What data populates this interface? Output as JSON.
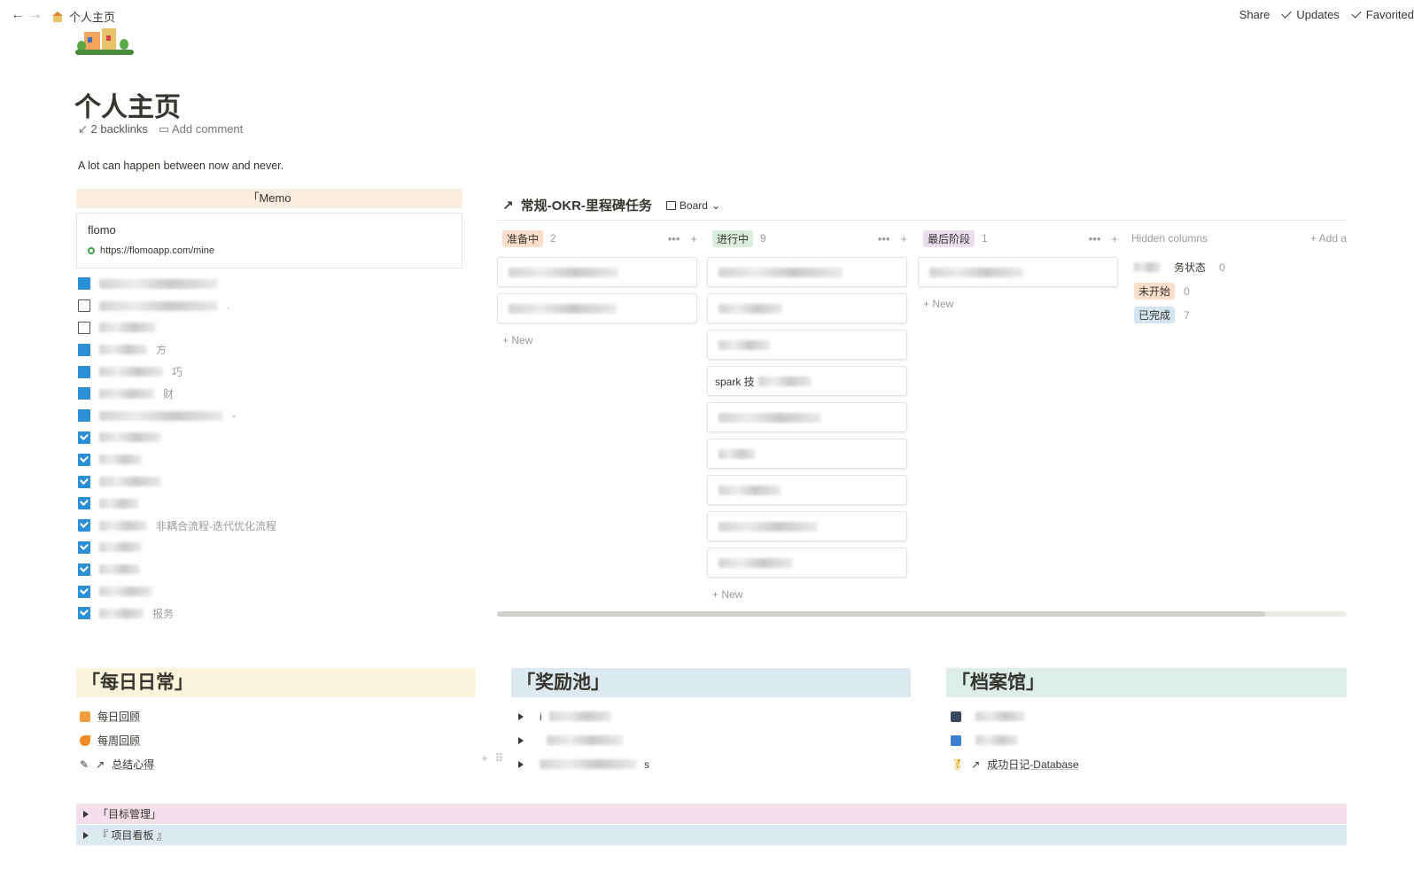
{
  "topbar": {
    "back": "←",
    "forward": "→",
    "breadcrumb": "个人主页",
    "share": "Share",
    "updates": "Updates",
    "favorited": "Favorited"
  },
  "page": {
    "title": "个人主页",
    "backlinks": "2 backlinks",
    "add_comment": "Add comment",
    "quote": "A lot can happen between now and never."
  },
  "memo": {
    "header": "「Memo",
    "bookmark_title": "flomo",
    "bookmark_url": "https://flomoapp.com/mine",
    "items": [
      {
        "type": "folder",
        "text": ""
      },
      {
        "type": "doc",
        "text": "."
      },
      {
        "type": "doc",
        "text": ""
      },
      {
        "type": "folder",
        "text": "方"
      },
      {
        "type": "folder",
        "text": "巧"
      },
      {
        "type": "folder",
        "text": "财"
      },
      {
        "type": "folder",
        "text": "-"
      },
      {
        "type": "check",
        "text": ""
      },
      {
        "type": "check",
        "text": ""
      },
      {
        "type": "check",
        "text": ""
      },
      {
        "type": "check",
        "text": ""
      },
      {
        "type": "check",
        "text": "非耦合流程-迭代优化流程"
      },
      {
        "type": "check",
        "text": ""
      },
      {
        "type": "check",
        "text": ""
      },
      {
        "type": "check",
        "text": ""
      },
      {
        "type": "check",
        "text": "报务"
      }
    ]
  },
  "board": {
    "title": "常规-OKR-里程碑任务",
    "view": "Board",
    "columns": [
      {
        "name": "准备中",
        "count": "2",
        "color": "#fadec9",
        "cards": [
          "",
          ""
        ],
        "new": "New"
      },
      {
        "name": "进行中",
        "count": "9",
        "color": "#dbeddb",
        "cards": [
          "",
          "",
          "",
          "spark 技",
          "",
          "",
          "",
          "",
          ""
        ],
        "new": "New"
      },
      {
        "name": "最后阶段",
        "count": "1",
        "color": "#e8deee",
        "cards": [
          ""
        ],
        "new": "New"
      }
    ],
    "hidden_title": "Hidden columns",
    "add_group": "Add a",
    "hidden": [
      {
        "name": "务状态",
        "count": "0",
        "color": "#ffffff"
      },
      {
        "name": "未开始",
        "count": "0",
        "color": "#fadec9"
      },
      {
        "name": "已完成",
        "count": "7",
        "color": "#d3e5ef"
      }
    ]
  },
  "sections": {
    "daily": {
      "title": "「每日日常」",
      "items": [
        "每日回顾",
        "每周回顾",
        "总结心得"
      ]
    },
    "reward": {
      "title": "「奖励池」",
      "items": [
        "i",
        "",
        "s"
      ]
    },
    "archive": {
      "title": "「档案馆」",
      "items": [
        "",
        "",
        "成功日记-Database"
      ]
    }
  },
  "toggles": [
    {
      "label": "「目标管理」",
      "color": "#f4dfeb"
    },
    {
      "label": "『 项目看板 』",
      "color": "#dde9f0"
    }
  ],
  "colors": {
    "memo_header": "#fbecdd",
    "daily_bg": "#fbf3db",
    "reward_bg": "#dde9f0",
    "archive_bg": "#ddedea",
    "checkbox": "#2b8fd6"
  }
}
